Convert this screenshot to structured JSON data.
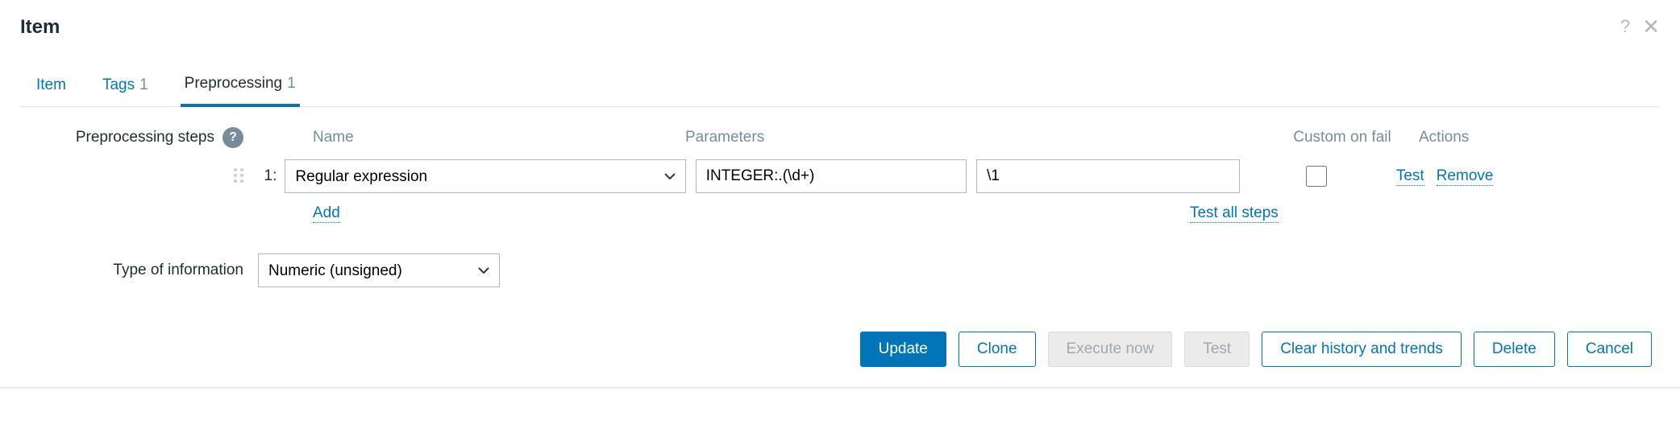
{
  "header": {
    "title": "Item"
  },
  "tabs": {
    "item": {
      "label": "Item"
    },
    "tags": {
      "label": "Tags",
      "count": "1"
    },
    "preprocessing": {
      "label": "Preprocessing",
      "count": "1"
    }
  },
  "labels": {
    "preprocessing_steps": "Preprocessing steps",
    "type_of_information": "Type of information"
  },
  "columns": {
    "name": "Name",
    "parameters": "Parameters",
    "custom_on_fail": "Custom on fail",
    "actions": "Actions"
  },
  "step": {
    "num": "1:",
    "name": "Regular expression",
    "param1": "INTEGER:.(\\d+)",
    "param2": "\\1"
  },
  "links": {
    "add": "Add",
    "test": "Test",
    "remove": "Remove",
    "test_all": "Test all steps"
  },
  "type_info": {
    "value": "Numeric (unsigned)"
  },
  "buttons": {
    "update": "Update",
    "clone": "Clone",
    "execute_now": "Execute now",
    "test": "Test",
    "clear_history": "Clear history and trends",
    "delete": "Delete",
    "cancel": "Cancel"
  }
}
